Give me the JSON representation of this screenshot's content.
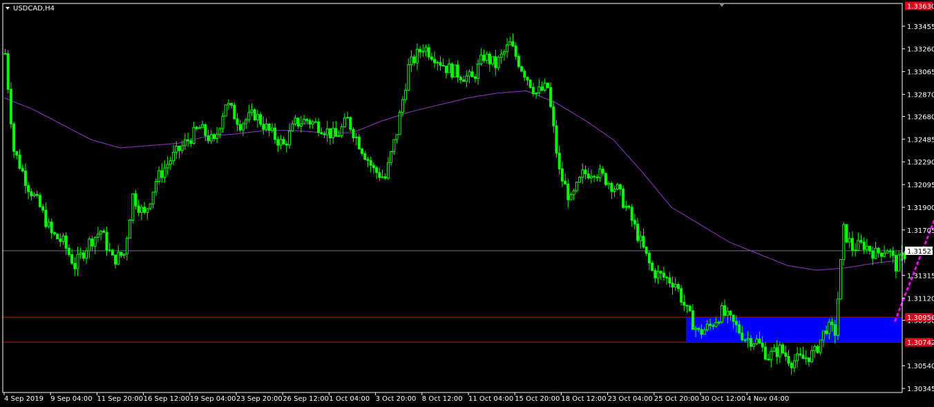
{
  "symbol_label": "USDCAD,H4",
  "colors": {
    "background": "#000000",
    "candle": "#00ff00",
    "moving_average": "#9933cc",
    "price_line": "#6c7b8b",
    "zone_fill": "#0000ff",
    "zone_border": "#ff0000",
    "arrow": "#ff00ff",
    "frame": "#ffffff"
  },
  "chart_data": {
    "type": "candlestick",
    "symbol": "USDCAD",
    "timeframe": "H4",
    "ylim": [
      1.3031,
      1.3365
    ],
    "y_ticks": [
      "1.33455",
      "1.33260",
      "1.33065",
      "1.32870",
      "1.32680",
      "1.32485",
      "1.32290",
      "1.32095",
      "1.31900",
      "1.31705",
      "1.31315",
      "1.31120",
      "1.30930",
      "1.30540",
      "1.30345"
    ],
    "x_ticks": [
      "4 Sep 2019",
      "9 Sep 04:00",
      "11 Sep 20:00",
      "16 Sep 12:00",
      "19 Sep 04:00",
      "23 Sep 20:00",
      "26 Sep 12:00",
      "1 Oct 04:00",
      "3 Oct 20:00",
      "8 Oct 12:00",
      "11 Oct 04:00",
      "15 Oct 20:00",
      "18 Oct 12:00",
      "23 Oct 04:00",
      "25 Oct 20:00",
      "30 Oct 12:00",
      "4 Nov 04:00"
    ],
    "top_price_tag": "1.33630",
    "current_price": 1.31527,
    "current_price_label": "1.31527",
    "price_path": [
      [
        0,
        1.3322
      ],
      [
        3,
        1.3239
      ],
      [
        8,
        1.3208
      ],
      [
        12,
        1.319
      ],
      [
        16,
        1.3167
      ],
      [
        20,
        1.316
      ],
      [
        24,
        1.314
      ],
      [
        29,
        1.316
      ],
      [
        33,
        1.317
      ],
      [
        37,
        1.3145
      ],
      [
        41,
        1.315
      ],
      [
        44,
        1.32
      ],
      [
        48,
        1.3183
      ],
      [
        52,
        1.3213
      ],
      [
        57,
        1.3231
      ],
      [
        62,
        1.3245
      ],
      [
        67,
        1.3258
      ],
      [
        72,
        1.3245
      ],
      [
        76,
        1.328
      ],
      [
        81,
        1.3262
      ],
      [
        86,
        1.327
      ],
      [
        91,
        1.3255
      ],
      [
        96,
        1.3243
      ],
      [
        100,
        1.3262
      ],
      [
        104,
        1.3265
      ],
      [
        109,
        1.3259
      ],
      [
        114,
        1.325
      ],
      [
        118,
        1.3265
      ],
      [
        122,
        1.3245
      ],
      [
        127,
        1.3222
      ],
      [
        131,
        1.3215
      ],
      [
        135,
        1.3255
      ],
      [
        139,
        1.331
      ],
      [
        144,
        1.3328
      ],
      [
        148,
        1.332
      ],
      [
        152,
        1.331
      ],
      [
        156,
        1.3305
      ],
      [
        161,
        1.33
      ],
      [
        165,
        1.332
      ],
      [
        169,
        1.3312
      ],
      [
        174,
        1.333
      ],
      [
        178,
        1.331
      ],
      [
        183,
        1.3288
      ],
      [
        187,
        1.3293
      ],
      [
        191,
        1.322
      ],
      [
        195,
        1.3195
      ],
      [
        199,
        1.3218
      ],
      [
        203,
        1.3222
      ],
      [
        207,
        1.3214
      ],
      [
        211,
        1.3205
      ],
      [
        215,
        1.3185
      ],
      [
        219,
        1.316
      ],
      [
        223,
        1.3135
      ],
      [
        227,
        1.313
      ],
      [
        231,
        1.3125
      ],
      [
        235,
        1.31
      ],
      [
        239,
        1.3082
      ],
      [
        243,
        1.3088
      ],
      [
        247,
        1.31
      ],
      [
        251,
        1.309
      ],
      [
        255,
        1.3078
      ],
      [
        259,
        1.3075
      ],
      [
        263,
        1.3062
      ],
      [
        267,
        1.3068
      ],
      [
        271,
        1.3058
      ],
      [
        275,
        1.306
      ],
      [
        279,
        1.3065
      ],
      [
        283,
        1.3087
      ],
      [
        286,
        1.3083
      ],
      [
        289,
        1.317
      ],
      [
        292,
        1.3155
      ],
      [
        296,
        1.3158
      ],
      [
        300,
        1.315
      ],
      [
        304,
        1.3155
      ],
      [
        307,
        1.314
      ],
      [
        310,
        1.315
      ]
    ],
    "ma_path": [
      [
        0,
        1.3284
      ],
      [
        10,
        1.3274
      ],
      [
        20,
        1.3261
      ],
      [
        30,
        1.3248
      ],
      [
        40,
        1.3241
      ],
      [
        50,
        1.3243
      ],
      [
        60,
        1.3245
      ],
      [
        70,
        1.3251
      ],
      [
        80,
        1.3253
      ],
      [
        90,
        1.3256
      ],
      [
        100,
        1.3256
      ],
      [
        110,
        1.3254
      ],
      [
        120,
        1.3254
      ],
      [
        130,
        1.3264
      ],
      [
        140,
        1.3272
      ],
      [
        150,
        1.3278
      ],
      [
        160,
        1.3284
      ],
      [
        170,
        1.3288
      ],
      [
        180,
        1.329
      ],
      [
        190,
        1.328
      ],
      [
        200,
        1.3265
      ],
      [
        210,
        1.3248
      ],
      [
        220,
        1.322
      ],
      [
        230,
        1.319
      ],
      [
        240,
        1.3175
      ],
      [
        250,
        1.316
      ],
      [
        260,
        1.315
      ],
      [
        270,
        1.314
      ],
      [
        280,
        1.3136
      ],
      [
        290,
        1.3138
      ],
      [
        300,
        1.3142
      ],
      [
        310,
        1.3145
      ]
    ],
    "support_zone": {
      "top": 1.30956,
      "bottom": 1.30742,
      "top_label": "1.30956",
      "bottom_label": "1.30742",
      "start_bar": 235
    },
    "arrow": {
      "from": [
        307,
        1.3092
      ],
      "to": [
        327,
        1.322
      ]
    }
  }
}
